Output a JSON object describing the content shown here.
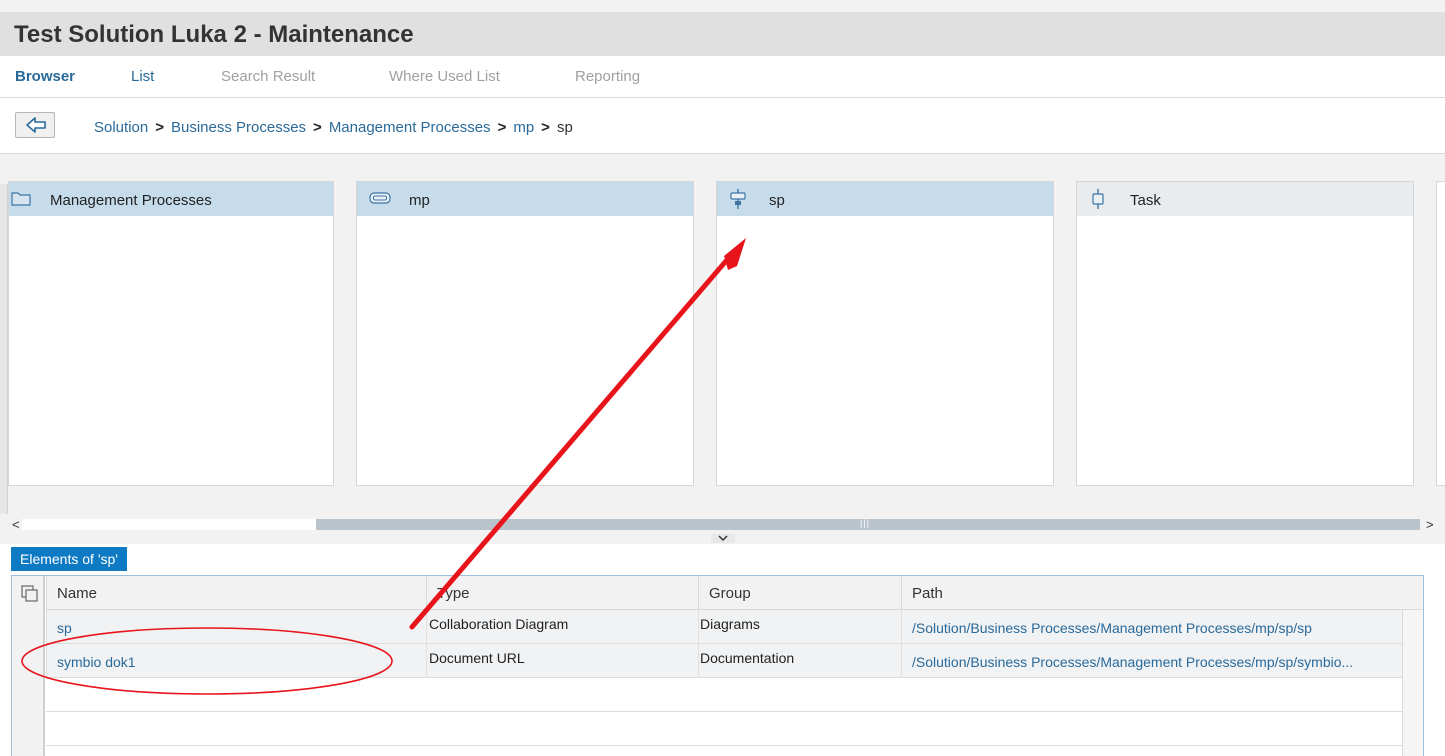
{
  "window": {
    "title": "Test Solution Luka 2 - Maintenance"
  },
  "tabs": [
    {
      "label": "Browser",
      "state": "active"
    },
    {
      "label": "List",
      "state": "link"
    },
    {
      "label": "Search Result",
      "state": "disabled"
    },
    {
      "label": "Where Used List",
      "state": "disabled"
    },
    {
      "label": "Reporting",
      "state": "disabled"
    }
  ],
  "breadcrumb": {
    "back_icon": "back-arrow-icon",
    "items": [
      "Solution",
      "Business Processes",
      "Management Processes",
      "mp"
    ],
    "separator": ">",
    "current": "sp"
  },
  "browser": {
    "columns": [
      {
        "label": "Management Processes",
        "icon": "folder-icon",
        "selected": true
      },
      {
        "label": "mp",
        "icon": "process-icon",
        "selected": true
      },
      {
        "label": "sp",
        "icon": "step-icon",
        "selected": true
      },
      {
        "label": "Task",
        "icon": "task-icon",
        "selected": false
      }
    ],
    "scroll": {
      "left": "<",
      "right": ">",
      "grip": "|||"
    }
  },
  "elements_panel": {
    "tab_label": "Elements of 'sp'",
    "headers": {
      "name": "Name",
      "type": "Type",
      "group": "Group",
      "path": "Path"
    },
    "rows": [
      {
        "name": "sp",
        "type": "Collaboration Diagram",
        "group": "Diagrams",
        "path": "/Solution/Business Processes/Management Processes/mp/sp/sp"
      },
      {
        "name": "symbio dok1",
        "type": "Document URL",
        "group": "Documentation",
        "path": "/Solution/Business Processes/Management Processes/mp/sp/symbio..."
      }
    ]
  },
  "colors": {
    "accent": "#2a6a9a",
    "tab_blue": "#0f7ac4",
    "selected_header": "#c6dceb",
    "annotation": "#e8141c"
  }
}
